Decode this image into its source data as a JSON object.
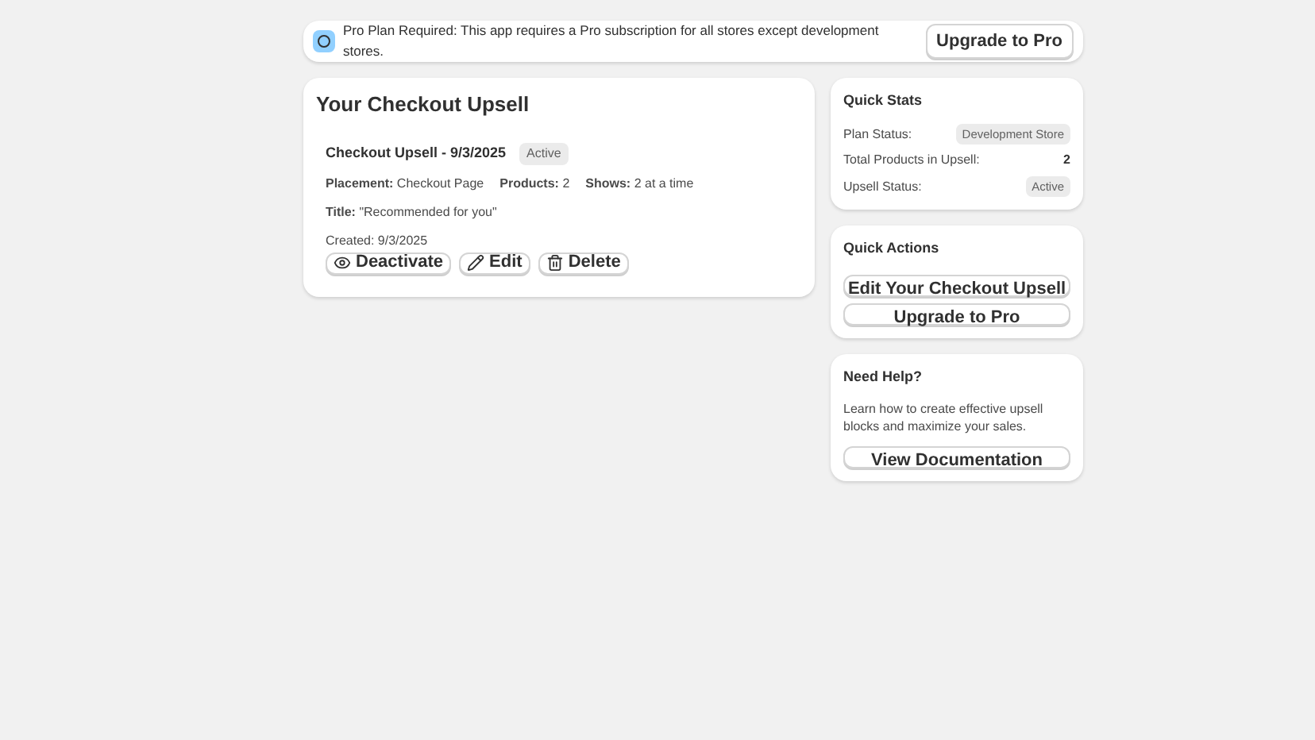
{
  "banner": {
    "text": "Pro Plan Required: This app requires a Pro subscription for all stores except development stores.",
    "button": "Upgrade to Pro"
  },
  "main": {
    "title": "Your Checkout Upsell",
    "upsell": {
      "name": "Checkout Upsell - 9/3/2025",
      "status": "Active",
      "meta": [
        "**Placement:** Checkout Page",
        "**Products:** 2",
        "**Shows:** 2 at a time"
      ],
      "title_line": "**Title:** \"Recommended for you\"",
      "created": "Created: 9/3/2025",
      "actions": [
        {
          "kind": "eye",
          "label": "Deactivate"
        },
        {
          "kind": "pencil",
          "label": "Edit"
        },
        {
          "kind": "trash",
          "label": "Delete"
        }
      ]
    }
  },
  "quick_stats": {
    "title": "Quick Stats",
    "rows": [
      {
        "label": "Plan Status:",
        "value": "Development Store",
        "kind": "badge"
      },
      {
        "label": "Total Products in Upsell:",
        "value": "2",
        "kind": "plain"
      },
      {
        "label": "Upsell Status:",
        "value": "Active",
        "kind": "badge"
      }
    ]
  },
  "quick_actions": {
    "title": "Quick Actions",
    "buttons": [
      "Edit Your Checkout Upsell",
      "Upgrade to Pro"
    ]
  },
  "help": {
    "title": "Need Help?",
    "text": "Learn how to create effective upsell blocks and maximize your sales.",
    "button": "View Documentation"
  }
}
